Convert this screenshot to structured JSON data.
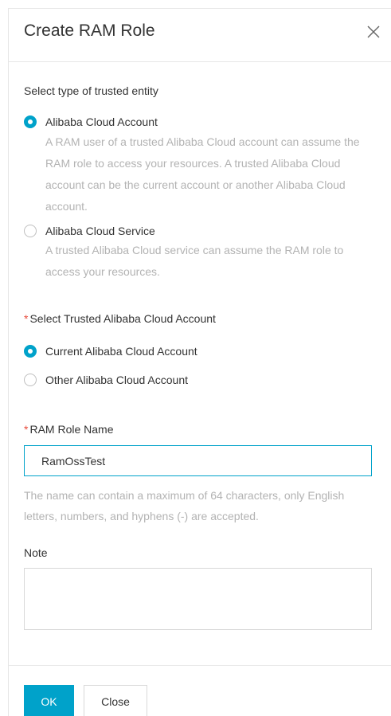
{
  "dialog": {
    "title": "Create RAM Role",
    "close_icon": "close-icon"
  },
  "trusted_entity": {
    "label": "Select type of trusted entity",
    "options": [
      {
        "label": "Alibaba Cloud Account",
        "checked": true,
        "description": "A RAM user of a trusted Alibaba Cloud account can assume the RAM role to access your resources. A trusted Alibaba Cloud account can be the current account or another Alibaba Cloud account."
      },
      {
        "label": "Alibaba Cloud Service",
        "checked": false,
        "description": "A trusted Alibaba Cloud service can assume the RAM role to access your resources."
      }
    ]
  },
  "trusted_account": {
    "required_mark": "*",
    "label": "Select Trusted Alibaba Cloud Account",
    "options": [
      {
        "label": "Current Alibaba Cloud Account",
        "checked": true
      },
      {
        "label": "Other Alibaba Cloud Account",
        "checked": false
      }
    ]
  },
  "role_name": {
    "required_mark": "*",
    "label": "RAM Role Name",
    "value": "RamOssTest",
    "hint": "The name can contain a maximum of 64 characters, only English letters, numbers, and hyphens (-) are accepted."
  },
  "note": {
    "label": "Note",
    "value": ""
  },
  "footer": {
    "ok_label": "OK",
    "close_label": "Close"
  },
  "colors": {
    "accent": "#00a2ca",
    "required": "#e84b3c",
    "muted_text": "#b3b3b3"
  }
}
